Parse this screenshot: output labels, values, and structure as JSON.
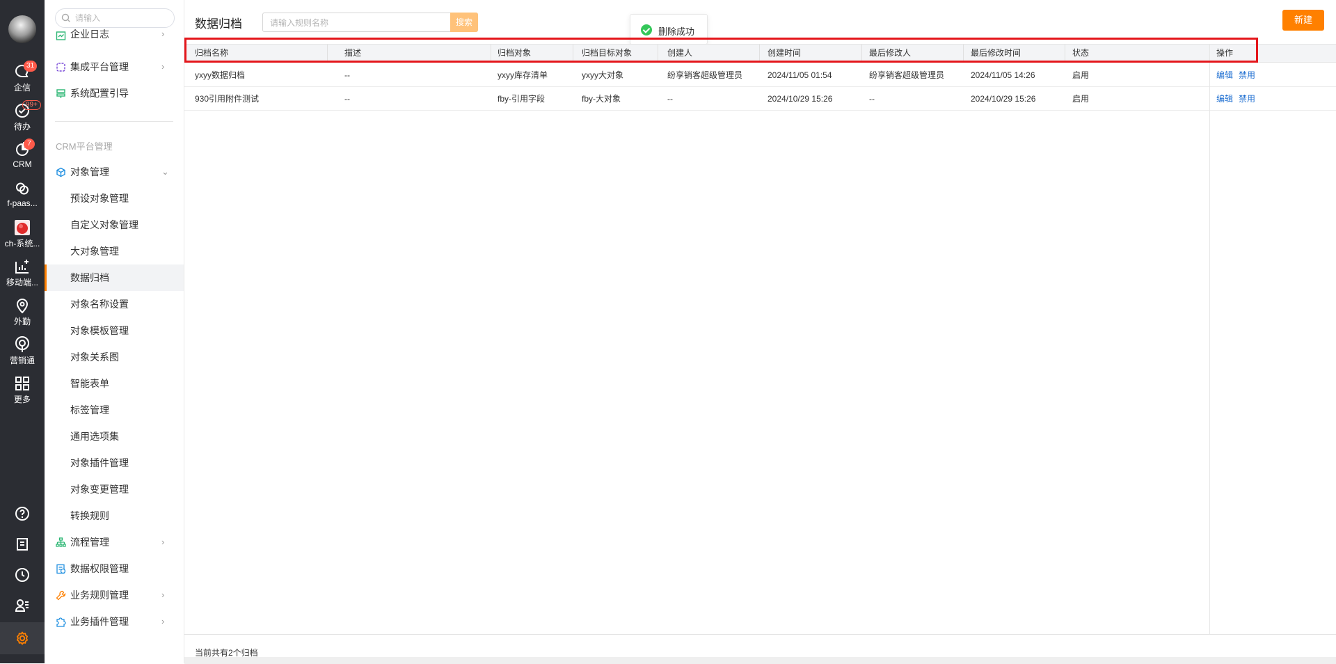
{
  "rail": {
    "items": [
      {
        "label": "企信",
        "badge": "31",
        "icon": "chat-bubble-icon"
      },
      {
        "label": "待办",
        "badge": "99+",
        "icon": "check-circle-icon"
      },
      {
        "label": "CRM",
        "badge": "7",
        "icon": "pie-chart-icon"
      },
      {
        "label": "f-paas...",
        "icon": "rings-icon"
      },
      {
        "label": "ch-系统...",
        "icon": "app-thumbnail-icon"
      },
      {
        "label": "移动端...",
        "icon": "chart-add-icon"
      },
      {
        "label": "外勤",
        "icon": "location-pin-icon"
      },
      {
        "label": "营销通",
        "icon": "broadcast-icon"
      },
      {
        "label": "更多",
        "icon": "grid-icon"
      }
    ],
    "bottom_icons": [
      "help-icon",
      "notebook-icon",
      "clock-icon",
      "user-list-icon",
      "settings-gear-icon"
    ]
  },
  "menu": {
    "search_placeholder": "请输入",
    "top_items": [
      {
        "label": "企业日志",
        "icon": "journal-icon"
      },
      {
        "label": "集成平台管理",
        "icon": "integration-icon"
      },
      {
        "label": "系统配置引导",
        "icon": "guide-icon"
      }
    ],
    "category": "CRM平台管理",
    "object_mgmt": {
      "label": "对象管理",
      "icon": "cube-icon"
    },
    "sub_items": [
      "预设对象管理",
      "自定义对象管理",
      "大对象管理",
      "数据归档",
      "对象名称设置",
      "对象模板管理",
      "对象关系图",
      "智能表单",
      "标签管理",
      "通用选项集",
      "对象插件管理",
      "对象变更管理",
      "转换规则"
    ],
    "active_item": "数据归档",
    "bottom_items": [
      {
        "label": "流程管理",
        "icon": "flow-icon"
      },
      {
        "label": "数据权限管理",
        "icon": "data-permission-icon"
      },
      {
        "label": "业务规则管理",
        "icon": "wrench-icon"
      },
      {
        "label": "业务插件管理",
        "icon": "puzzle-icon"
      }
    ],
    "collapse": "«"
  },
  "main": {
    "title": "数据归档",
    "search_placeholder": "请输入规则名称",
    "search_button": "搜索",
    "toast": "删除成功",
    "new_button": "新建",
    "columns": [
      "归档名称",
      "描述",
      "归档对象",
      "归档目标对象",
      "创建人",
      "创建时间",
      "最后修改人",
      "最后修改时间",
      "状态",
      "操作"
    ],
    "rows": [
      {
        "name": "yxyy数据归档",
        "desc": "--",
        "object": "yxyy库存清单",
        "target": "yxyy大对象",
        "creator": "纷享销客超级管理员",
        "created": "2024/11/05 01:54",
        "modifier": "纷享销客超级管理员",
        "modified": "2024/11/05 14:26",
        "status": "启用",
        "edit": "编辑",
        "disable": "禁用"
      },
      {
        "name": "930引用附件测试",
        "desc": "--",
        "object": "fby-引用字段",
        "target": "fby-大对象",
        "creator": "--",
        "created": "2024/10/29 15:26",
        "modifier": "--",
        "modified": "2024/10/29 15:26",
        "status": "启用",
        "edit": "编辑",
        "disable": "禁用"
      }
    ],
    "footer": "当前共有2个归档"
  },
  "colors": {
    "accent": "#ff8000",
    "link": "#1f6fd1",
    "highlight": "#e4161b",
    "rail_bg": "#2b2d33"
  }
}
